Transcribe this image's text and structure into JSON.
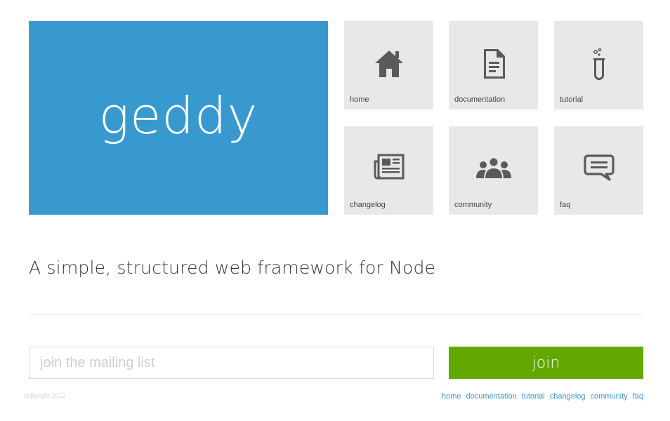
{
  "hero": {
    "title": "geddy",
    "color": "#3899cf"
  },
  "tiles": [
    {
      "label": "home",
      "icon": "home-icon"
    },
    {
      "label": "documentation",
      "icon": "document-icon"
    },
    {
      "label": "tutorial",
      "icon": "test-tube-icon"
    },
    {
      "label": "changelog",
      "icon": "newspaper-icon"
    },
    {
      "label": "community",
      "icon": "people-icon"
    },
    {
      "label": "faq",
      "icon": "speech-bubble-icon"
    }
  ],
  "tagline": "A simple, structured web framework for Node",
  "mailing": {
    "placeholder": "join the mailing list",
    "button_label": "join",
    "button_color": "#62a800"
  },
  "footer": {
    "copyright": "copyright 2012",
    "links": [
      "home",
      "documentation",
      "tutorial",
      "changelog",
      "community",
      "faq"
    ]
  }
}
